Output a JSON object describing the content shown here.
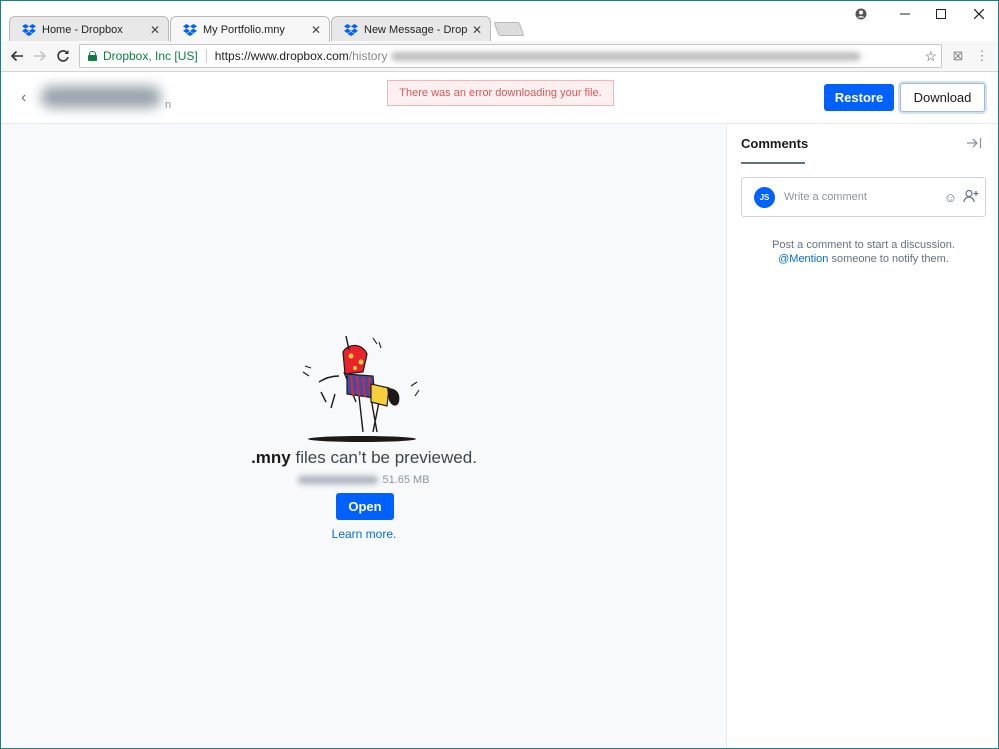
{
  "browser": {
    "tabs": [
      {
        "title": "Home - Dropbox",
        "active": false,
        "icon": "dropbox-icon"
      },
      {
        "title": "My Portfolio.mny",
        "active": true,
        "icon": "dropbox-icon"
      },
      {
        "title": "New Message - Dropbox",
        "active": false,
        "icon": "dropbox-icon"
      }
    ],
    "tab_close_glyph": "✕",
    "address": {
      "secure_label": "Dropbox, Inc [US]",
      "url_host": "https://www.dropbox.com",
      "url_path": "/history"
    },
    "colors": {
      "secure": "#0b8043",
      "frame": "#1e7d8c"
    }
  },
  "header": {
    "name_suffix": "n",
    "error_message": "There was an error downloading your file.",
    "restore_label": "Restore",
    "download_label": "Download"
  },
  "preview": {
    "ext": ".mny",
    "message_rest": " files can’t be previewed.",
    "file_size": "51.65 MB",
    "open_label": "Open",
    "learn_more": "Learn more."
  },
  "comments": {
    "tab_label": "Comments",
    "avatar_initials": "JS",
    "placeholder": "Write a comment",
    "empty_line1": "Post a comment to start a discussion.",
    "empty_mention": "@Mention",
    "empty_line2_rest": " someone to notify them."
  },
  "colors": {
    "primary": "#0061fe",
    "error_text": "#d2595b",
    "link": "#0070e0"
  }
}
